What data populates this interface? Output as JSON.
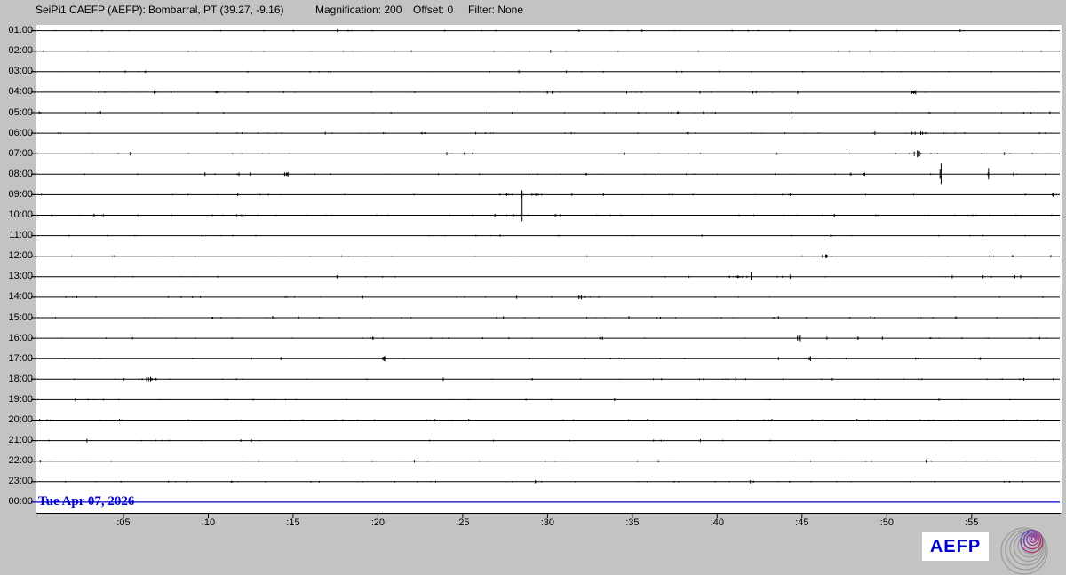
{
  "header": {
    "station": "SeiPi1 CAEFP (AEFP):",
    "location": "Bombarral, PT (39.27, -9.16)",
    "magnification": "Magnification: 200",
    "offset": "Offset: 0",
    "filter": "Filter: None"
  },
  "plot": {
    "date_label": "Tue Apr 07, 2026",
    "row_labels": [
      "01:00",
      "02:00",
      "03:00",
      "04:00",
      "05:00",
      "06:00",
      "07:00",
      "08:00",
      "09:00",
      "10:00",
      "11:00",
      "12:00",
      "13:00",
      "14:00",
      "15:00",
      "16:00",
      "17:00",
      "18:00",
      "19:00",
      "20:00",
      "21:00",
      "22:00",
      "23:00",
      "00:00"
    ],
    "x_tick_labels": [
      ":05",
      ":10",
      ":15",
      ":20",
      ":25",
      ":30",
      ":35",
      ":40",
      ":45",
      ":50",
      ":55"
    ],
    "colors": {
      "background": "#c3c3c3",
      "plot_background": "#ffffff",
      "trace": "#000000",
      "current_day_trace": "#0000cc",
      "date_text": "#0000cc",
      "logo_text": "#0000cc"
    },
    "events": [
      {
        "r": "03:00",
        "m": 6.3,
        "a": 1.2,
        "w": 3
      },
      {
        "r": "04:00",
        "m": 6.8,
        "a": 1.8,
        "w": 6
      },
      {
        "r": "04:00",
        "m": 7.8,
        "a": 1.2,
        "w": 3
      },
      {
        "r": "04:00",
        "m": 10.5,
        "a": 1.2,
        "w": 8
      },
      {
        "r": "04:00",
        "m": 42.1,
        "a": 1.8,
        "w": 8
      },
      {
        "r": "04:00",
        "m": 51.7,
        "a": 2.5,
        "w": 10
      },
      {
        "r": "05:00",
        "m": 37.7,
        "a": 1.5,
        "w": 3
      },
      {
        "r": "06:00",
        "m": 22.6,
        "a": 1.3,
        "w": 6
      },
      {
        "r": "06:00",
        "m": 38.3,
        "a": 1.5,
        "w": 4
      },
      {
        "r": "06:00",
        "m": 49.3,
        "a": 2.0,
        "w": 4
      },
      {
        "r": "06:00",
        "m": 52.0,
        "a": 2.0,
        "w": 14
      },
      {
        "r": "07:00",
        "m": 5.4,
        "a": 2.0,
        "w": 3
      },
      {
        "r": "07:00",
        "m": 51.8,
        "a": 4.0,
        "w": 8
      },
      {
        "r": "08:00",
        "m": 9.8,
        "a": 2.0,
        "w": 4
      },
      {
        "r": "08:00",
        "m": 14.7,
        "a": 2.5,
        "w": 8
      },
      {
        "r": "08:00",
        "m": 32.3,
        "a": 1.3,
        "w": 3
      },
      {
        "r": "08:00",
        "m": 48.7,
        "a": 1.8,
        "w": 4
      },
      {
        "r": "08:00",
        "m": 53.2,
        "a": 12.0,
        "d": 11.0,
        "w": 4
      },
      {
        "r": "08:00",
        "m": 56.0,
        "a": 7.0,
        "d": 6.0,
        "w": 2
      },
      {
        "r": "09:00",
        "m": 27.6,
        "a": 1.5,
        "w": 20
      },
      {
        "r": "09:00",
        "m": 28.5,
        "a": 5.0,
        "d": 30.0,
        "w": 2
      },
      {
        "r": "09:00",
        "m": 29.3,
        "a": 1.5,
        "w": 10
      },
      {
        "r": "09:00",
        "m": 33.3,
        "a": 1.3,
        "w": 3
      },
      {
        "r": "09:00",
        "m": 44.3,
        "a": 1.3,
        "w": 6
      },
      {
        "r": "09:00",
        "m": 59.8,
        "a": 2.5,
        "w": 4
      },
      {
        "r": "10:00",
        "m": 28.0,
        "a": 1.3,
        "w": 16
      },
      {
        "r": "10:00",
        "m": 30.5,
        "a": 1.3,
        "w": 12
      },
      {
        "r": "11:00",
        "m": 39.1,
        "a": 1.2,
        "w": 3
      },
      {
        "r": "11:00",
        "m": 46.7,
        "a": 1.4,
        "w": 3
      },
      {
        "r": "12:00",
        "m": 46.4,
        "a": 2.2,
        "w": 8
      },
      {
        "r": "12:00",
        "m": 57.4,
        "a": 1.3,
        "w": 3
      },
      {
        "r": "13:00",
        "m": 41.2,
        "a": 1.6,
        "w": 22
      },
      {
        "r": "13:00",
        "m": 42.0,
        "a": 5.0,
        "d": 4.0,
        "w": 3
      },
      {
        "r": "13:00",
        "m": 44.3,
        "a": 2.2,
        "w": 4
      },
      {
        "r": "13:00",
        "m": 57.5,
        "a": 2.0,
        "w": 4
      },
      {
        "r": "14:00",
        "m": 32.0,
        "a": 2.5,
        "w": 10
      },
      {
        "r": "16:00",
        "m": 19.7,
        "a": 1.8,
        "w": 4
      },
      {
        "r": "16:00",
        "m": 44.9,
        "a": 3.5,
        "w": 8
      },
      {
        "r": "16:00",
        "m": 48.3,
        "a": 1.8,
        "w": 4
      },
      {
        "r": "17:00",
        "m": 20.4,
        "a": 3.0,
        "w": 6
      },
      {
        "r": "17:00",
        "m": 45.5,
        "a": 2.8,
        "w": 4
      },
      {
        "r": "17:00",
        "m": 51.7,
        "a": 1.3,
        "w": 3
      },
      {
        "r": "18:00",
        "m": 6.6,
        "a": 2.5,
        "w": 14
      },
      {
        "r": "18:00",
        "m": 29.1,
        "a": 1.3,
        "w": 4
      }
    ]
  },
  "footer": {
    "logo_text": "AEFP"
  }
}
